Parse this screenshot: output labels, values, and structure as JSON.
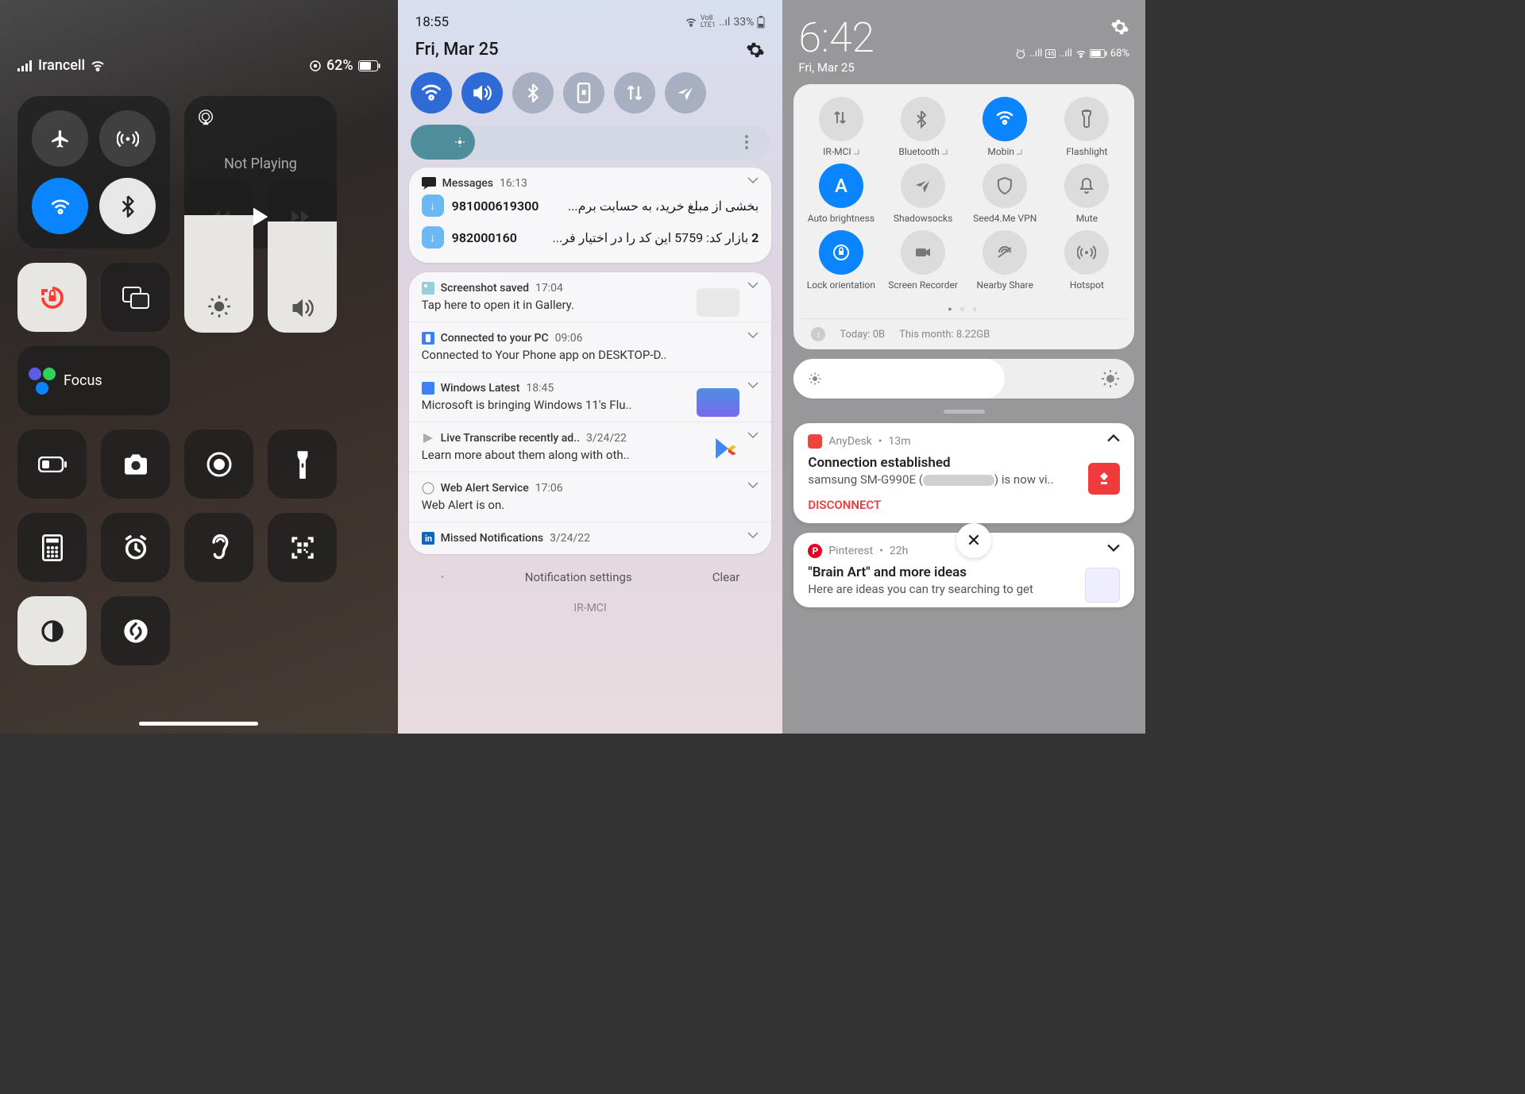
{
  "ios": {
    "carrier": "Irancell",
    "battery": "62%",
    "music_status": "Not Playing",
    "focus": "Focus"
  },
  "samsung": {
    "time": "18:55",
    "battery": "33%",
    "date": "Fri, Mar 25",
    "toggles": [
      "wifi",
      "sound",
      "bluetooth",
      "rotate-lock",
      "data-sync",
      "location-off"
    ],
    "msg": {
      "app": "Messages",
      "time": "16:13",
      "row1_num": "981000619300",
      "row1_txt": "بخشی از مبلغ خرید، به حسابت برم...",
      "row2_num": "982000160",
      "row2_cnt": "2",
      "row2_txt": "بازار کد: 5759 این کد را در اختیار فر..."
    },
    "n2": {
      "title": "Screenshot saved",
      "time": "17:04",
      "body": "Tap here to open it in Gallery."
    },
    "n3": {
      "title": "Connected to your PC",
      "time": "09:06",
      "body": "Connected to Your Phone app on DESKTOP-D.."
    },
    "n4": {
      "title": "Windows Latest",
      "time": "18:45",
      "body": "Microsoft is bringing Windows 11's Flu.."
    },
    "n5": {
      "title": "Live Transcribe recently ad..",
      "time": "3/24/22",
      "body": "Learn more about them along with oth.."
    },
    "n6": {
      "title": "Web Alert Service",
      "time": "17:06",
      "body": "Web Alert is on."
    },
    "n7": {
      "title": "Missed Notifications",
      "time": "3/24/22"
    },
    "footer_settings": "Notification settings",
    "footer_clear": "Clear",
    "carrier": "IR-MCI"
  },
  "xi": {
    "clock": "6:42",
    "date": "Fri, Mar 25",
    "battery": "68%",
    "tg": [
      {
        "label": "IR-MCI",
        "icon": "data-arrows",
        "chev": true
      },
      {
        "label": "Bluetooth",
        "icon": "bluetooth",
        "chev": true
      },
      {
        "label": "Mobin",
        "icon": "wifi",
        "active": true,
        "chev": true
      },
      {
        "label": "Flashlight",
        "icon": "flashlight"
      },
      {
        "label": "Auto brightness",
        "icon": "A",
        "active": true,
        "text": true
      },
      {
        "label": "Shadowsocks",
        "icon": "plane-off"
      },
      {
        "label": "Seed4.Me VPN",
        "icon": "shield"
      },
      {
        "label": "Mute",
        "icon": "bell"
      },
      {
        "label": "Lock orientation",
        "icon": "lock-rot",
        "active": true
      },
      {
        "label": "Screen Recorder",
        "icon": "video"
      },
      {
        "label": "Nearby Share",
        "icon": "nearby"
      },
      {
        "label": "Hotspot",
        "icon": "hotspot"
      }
    ],
    "usage_today": "Today: 0B",
    "usage_month": "This month: 8.22GB",
    "anydesk": {
      "app": "AnyDesk",
      "time": "13m",
      "title": "Connection established",
      "body_a": "samsung SM-G990E (",
      "body_b": ") is now vi..",
      "action": "DISCONNECT"
    },
    "pinterest": {
      "app": "Pinterest",
      "time": "22h",
      "title": "\"Brain Art\" and more ideas",
      "body": "Here are ideas you can try searching to get"
    }
  }
}
